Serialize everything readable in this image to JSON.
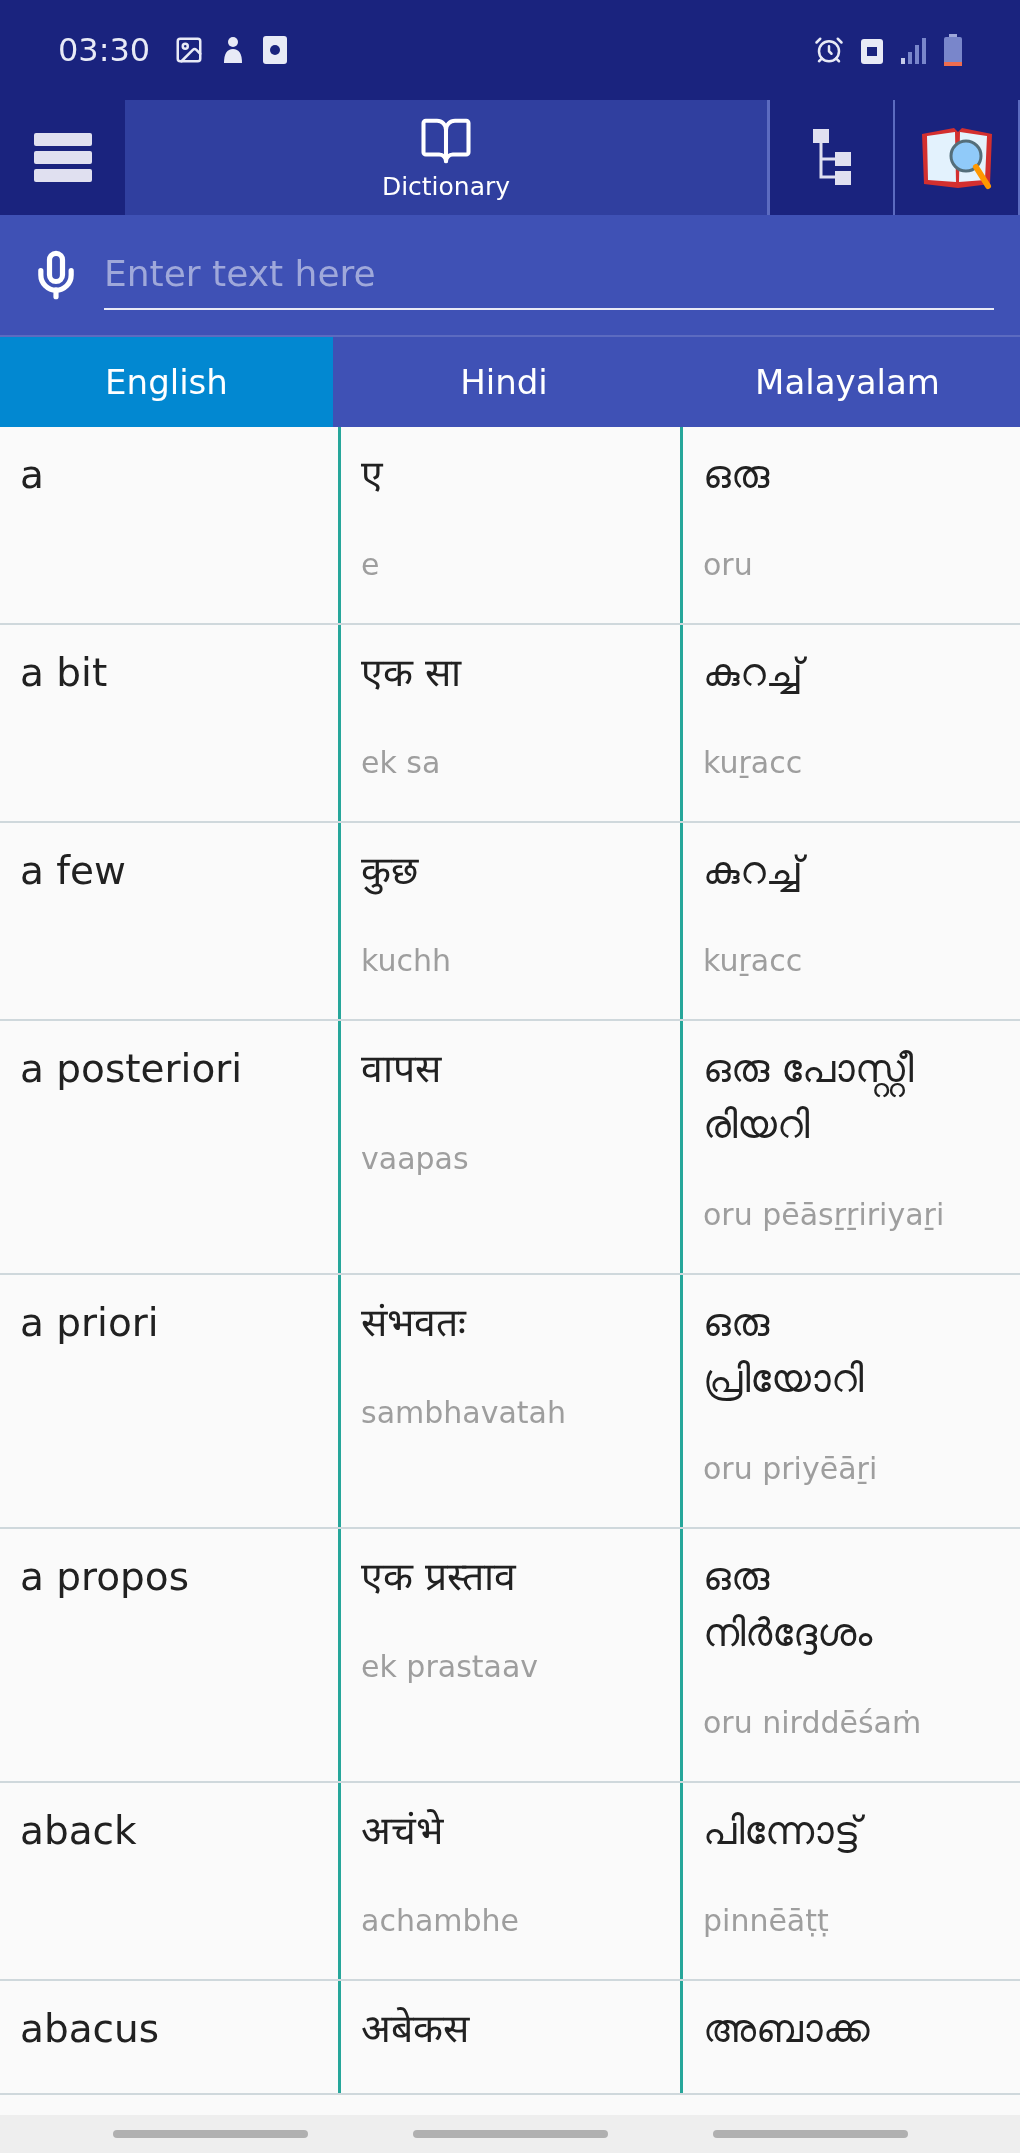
{
  "status_bar": {
    "time": "03:30"
  },
  "toolbar": {
    "tab": {
      "label": "Dictionary",
      "selected": true
    }
  },
  "search": {
    "placeholder": "Enter text here"
  },
  "languages": [
    {
      "label": "English",
      "selected": true
    },
    {
      "label": "Hindi",
      "selected": false
    },
    {
      "label": "Malayalam",
      "selected": false
    }
  ],
  "rows": [
    {
      "english": "a",
      "hindi": {
        "word": "ए",
        "translit": "e"
      },
      "malayalam": {
        "word": "ഒരു",
        "translit": "oru"
      }
    },
    {
      "english": "a bit",
      "hindi": {
        "word": "एक सा",
        "translit": "ek sa"
      },
      "malayalam": {
        "word": "കുറച്ച്",
        "translit": "kuṟacc"
      }
    },
    {
      "english": "a few",
      "hindi": {
        "word": "कुछ",
        "translit": "kuchh"
      },
      "malayalam": {
        "word": "കുറച്ച്",
        "translit": "kuṟacc"
      }
    },
    {
      "english": "a posteriori",
      "hindi": {
        "word": "वापस",
        "translit": "vaapas"
      },
      "malayalam": {
        "word": "ഒരു പോസ്റ്റീ രിയറി",
        "translit": "oru pēāsṟṟiriyaṟi"
      }
    },
    {
      "english": "a priori",
      "hindi": {
        "word": "संभवतः",
        "translit": "sambhavatah"
      },
      "malayalam": {
        "word": "ഒരു പ്രിയോറി",
        "translit": "oru priyēāṟi"
      }
    },
    {
      "english": "a propos",
      "hindi": {
        "word": "एक प्रस्ताव",
        "translit": "ek prastaav"
      },
      "malayalam": {
        "word": "ഒരു നിർദ്ദേശം",
        "translit": "oru nirddēśaṁ"
      }
    },
    {
      "english": "aback",
      "hindi": {
        "word": "अचंभे",
        "translit": "achambhe"
      },
      "malayalam": {
        "word": "പിന്നോട്ട്",
        "translit": "pinnēāṭṭ"
      }
    },
    {
      "english": "abacus",
      "hindi": {
        "word": "अबेकस"
      },
      "malayalam": {
        "word": "അബാക്ക"
      }
    }
  ]
}
